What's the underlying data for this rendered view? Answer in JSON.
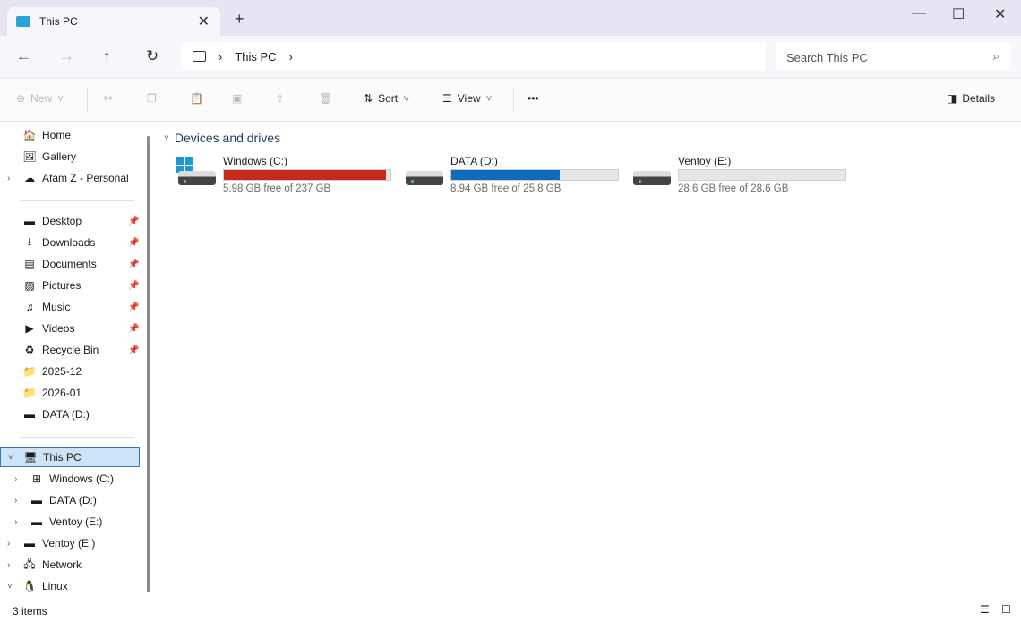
{
  "tab": {
    "title": "This PC",
    "close": "✕",
    "new": "+"
  },
  "window": {
    "minimize": "—",
    "maximize": "☐",
    "close": "✕"
  },
  "address": {
    "crumbs": [
      "This PC"
    ],
    "search_placeholder": "Search This PC"
  },
  "toolbar": {
    "new": "New",
    "sort": "Sort",
    "view": "View",
    "more": "•••",
    "details": "Details"
  },
  "sidebar": {
    "quick": [
      {
        "label": "Home",
        "icon": "home-icon"
      },
      {
        "label": "Gallery",
        "icon": "gallery-icon"
      },
      {
        "label": "Afam Z - Personal",
        "icon": "onedrive-icon"
      }
    ],
    "pinned": [
      {
        "label": "Desktop"
      },
      {
        "label": "Downloads"
      },
      {
        "label": "Documents"
      },
      {
        "label": "Pictures"
      },
      {
        "label": "Music"
      },
      {
        "label": "Videos"
      },
      {
        "label": "Recycle Bin"
      },
      {
        "label": "2025-12"
      },
      {
        "label": "2026-01"
      },
      {
        "label": "DATA (D:)"
      }
    ],
    "tree": [
      {
        "label": "This PC"
      },
      {
        "label": "Windows (C:)"
      },
      {
        "label": "DATA (D:)"
      },
      {
        "label": "Ventoy (E:)"
      },
      {
        "label": "Ventoy (E:)"
      },
      {
        "label": "Network"
      },
      {
        "label": "Linux"
      }
    ]
  },
  "main": {
    "group": "Devices and drives",
    "drives": [
      {
        "name": "Windows (C:)",
        "free": "5.98 GB free of 237 GB",
        "used_fraction": 0.975,
        "color": "#c42b1c"
      },
      {
        "name": "DATA (D:)",
        "free": "8.94 GB free of 25.8 GB",
        "used_fraction": 0.653,
        "color": "#0f6cbd"
      },
      {
        "name": "Ventoy (E:)",
        "free": "28.6 GB free of 28.6 GB",
        "used_fraction": 0.0,
        "color": "#0f6cbd"
      }
    ]
  },
  "status": {
    "items": "3 items"
  }
}
